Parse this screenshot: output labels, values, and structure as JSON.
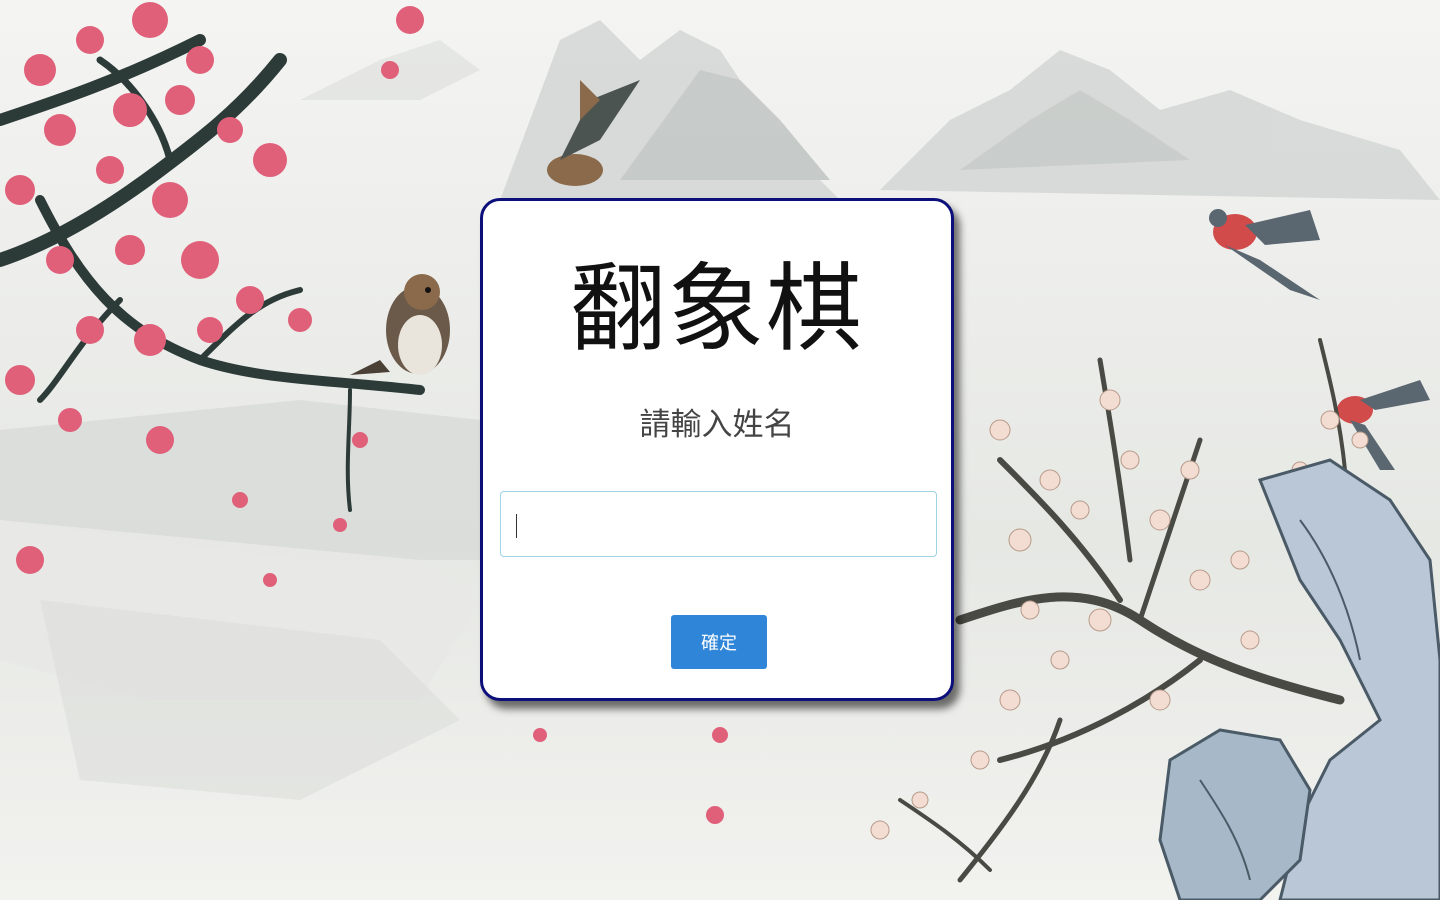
{
  "dialog": {
    "title": "翻象棋",
    "prompt": "請輸入姓名",
    "name_input": {
      "value": "",
      "placeholder": ""
    },
    "confirm_label": "確定"
  },
  "colors": {
    "dialog_border": "#0d0f7a",
    "button_bg": "#2f86d9",
    "blossom": "#e0607a",
    "branch": "#2c3a38"
  },
  "background": {
    "description_icons": [
      "plum-blossom-branch",
      "mountain",
      "bird"
    ]
  }
}
